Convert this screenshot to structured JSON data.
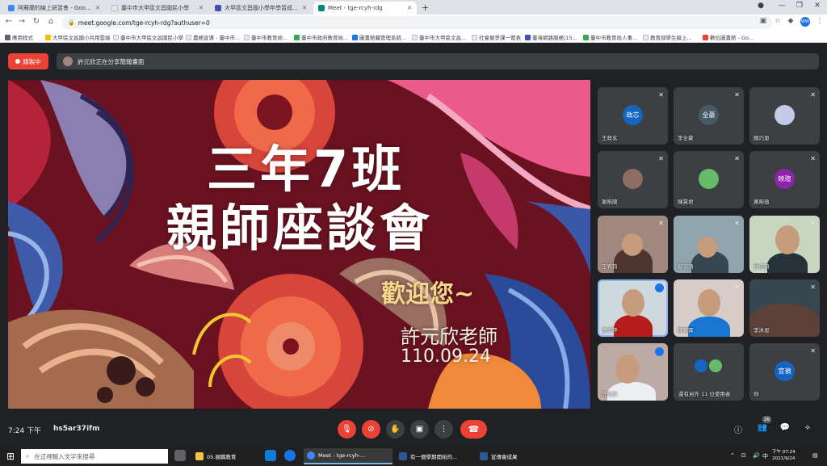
{
  "browser": {
    "tabs": [
      {
        "title": "阿蘇蘭的線上研習會 - Google 文件",
        "color": "#4285f4"
      },
      {
        "title": "臺中市大甲區文昌國民小學",
        "color": "#e8eaed"
      },
      {
        "title": "大甲區文昌國小學年學習成...",
        "color": "#3f51b5"
      },
      {
        "title": "Meet - tge-rcyh-rdg",
        "color": "#00897b"
      }
    ],
    "new_tab": "+",
    "url": "meet.google.com/tge-rcyh-rdg?authuser=0",
    "profile_initials": "WW",
    "bookmarks": [
      {
        "label": "應用程式",
        "color": "#5f6368"
      },
      {
        "label": "大甲區文昌國小共用雲端",
        "color": "#fbbc04"
      },
      {
        "label": "臺中市大甲區文昌國民小學",
        "color": "#e8eaed"
      },
      {
        "label": "農務宣導 - 臺中市...",
        "color": "#e8eaed"
      },
      {
        "label": "臺中市教育局...",
        "color": "#e8eaed"
      },
      {
        "label": "臺中市政府教育局...",
        "color": "#34a853"
      },
      {
        "label": "圖書館藏管理系統...",
        "color": "#1a73e8"
      },
      {
        "label": "臺中市大甲區文昌...",
        "color": "#e8eaed"
      },
      {
        "label": "社會競爭課一覽表",
        "color": "#e8eaed"
      },
      {
        "label": "臺灣網路服務|15...",
        "color": "#3f51b5"
      },
      {
        "label": "臺中市教育局人事...",
        "color": "#34a853"
      },
      {
        "label": "教育部學生線上...",
        "color": "#e8eaed"
      },
      {
        "label": "數位圖書館 - Go...",
        "color": "#ea4335"
      }
    ]
  },
  "meet": {
    "recording_label": "錄製中",
    "presenting_banner": "許元欣正在分享簡報畫面",
    "slide": {
      "title_line1": "三年7班",
      "title_line2": "親師座談會",
      "welcome": "歡迎您~",
      "teacher": "許元欣老師",
      "date": "110.09.24"
    },
    "participants": [
      {
        "name": "王政玄",
        "initials": "政芯",
        "color": "#1565c0",
        "type": "avatar"
      },
      {
        "name": "李全豪",
        "initials": "全豪",
        "color": "#455a64",
        "type": "avatar"
      },
      {
        "name": "顏巧恩",
        "initials": "",
        "color": "#c5cae9",
        "type": "avatar"
      },
      {
        "name": "謝皓陽",
        "initials": "",
        "color": "#8d6e63",
        "type": "avatar"
      },
      {
        "name": "陳慧君",
        "initials": "",
        "color": "#66bb6a",
        "type": "avatar"
      },
      {
        "name": "黃映瑄",
        "initials": "映瑄",
        "color": "#8e24aa",
        "type": "avatar"
      },
      {
        "name": "王宥鈞",
        "initials": "",
        "color": "#a1887f",
        "type": "video"
      },
      {
        "name": "蔡羽涵",
        "initials": "",
        "color": "#90a4ae",
        "type": "video"
      },
      {
        "name": "林佳穎",
        "initials": "",
        "color": "#c8d6c0",
        "type": "video"
      },
      {
        "name": "張萃萍",
        "initials": "",
        "color": "#cfd8dc",
        "type": "video"
      },
      {
        "name": "陳宥霖",
        "initials": "",
        "color": "#d7ccc8",
        "type": "video"
      },
      {
        "name": "李沐恩",
        "initials": "",
        "color": "#37474f",
        "type": "video"
      },
      {
        "name": "許元欣",
        "initials": "",
        "color": "#bcaaa4",
        "type": "video"
      },
      {
        "name": "還有另外 11 位使用者",
        "initials": "",
        "color": "#3c4043",
        "type": "more"
      },
      {
        "name": "你",
        "initials": "宜禎",
        "color": "#1565c0",
        "type": "avatar"
      }
    ],
    "time": "7:24 下午",
    "meeting_code": "hs5ar37ifm",
    "people_count": "26"
  },
  "taskbar": {
    "search_placeholder": "在這裡輸入文字來搜尋",
    "items": [
      {
        "label": "05.親職教育",
        "color": "#f6c443"
      },
      {
        "label": "Meet - tge-rcyh-...",
        "color": "#4285f4"
      },
      {
        "label": "有一個學期開始的...",
        "color": "#2b579a"
      },
      {
        "label": "宣傳會成果",
        "color": "#2b579a"
      }
    ],
    "clock_time": "下午 07:24",
    "clock_date": "2021/9/24"
  },
  "colors": {
    "meet_bg": "#202124",
    "record_red": "#ea4335",
    "slide_bg": "#6b1220"
  }
}
